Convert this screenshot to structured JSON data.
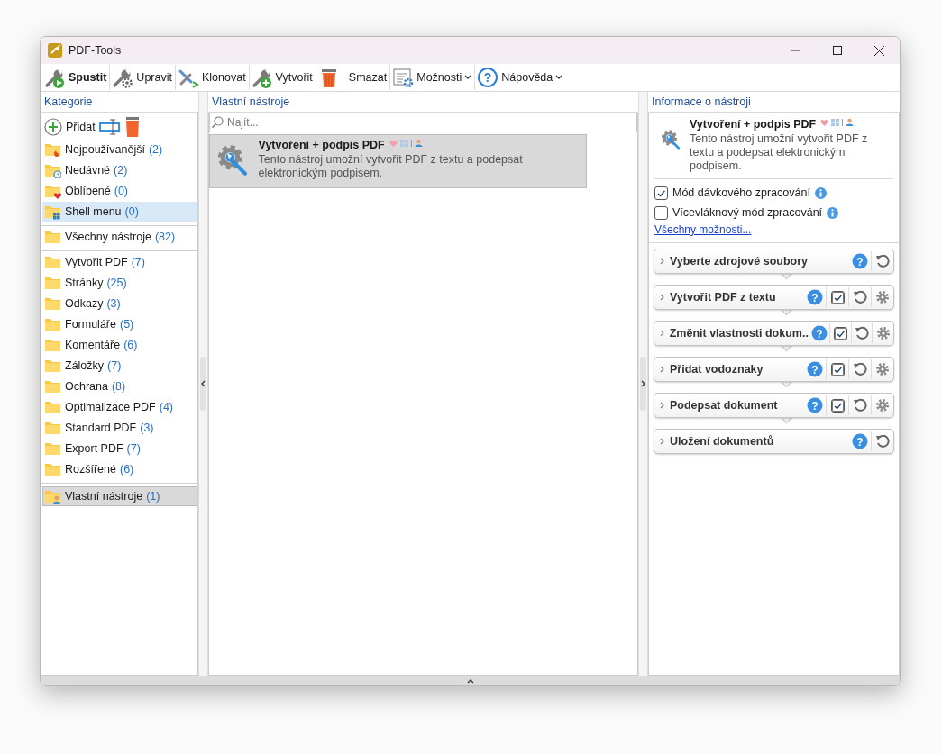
{
  "window": {
    "title": "PDF-Tools"
  },
  "toolbar": [
    {
      "label": "Spustit",
      "kind": "run",
      "default": true,
      "dropdown": false
    },
    {
      "label": "Upravit",
      "kind": "edit",
      "default": false,
      "dropdown": false
    },
    {
      "label": "Klonovat",
      "kind": "clone",
      "default": false,
      "dropdown": false
    },
    {
      "label": "Vytvořit",
      "kind": "create",
      "default": false,
      "dropdown": false
    },
    {
      "label": "Smazat",
      "kind": "delete",
      "default": false,
      "dropdown": false
    },
    {
      "label": "Možnosti",
      "kind": "options",
      "default": false,
      "dropdown": true
    },
    {
      "label": "Nápověda",
      "kind": "help",
      "default": false,
      "dropdown": true,
      "glyph": "?"
    }
  ],
  "categories": {
    "header": "Kategorie",
    "add_label": "Přidat",
    "groups": [
      [
        {
          "name": "Nejpoužívanější",
          "count": "(2)",
          "kind": "fire",
          "hovered": false,
          "selected": false
        },
        {
          "name": "Nedávné",
          "count": "(2)",
          "kind": "clock",
          "hovered": false,
          "selected": false
        },
        {
          "name": "Oblíbené",
          "count": "(0)",
          "kind": "heart",
          "hovered": false,
          "selected": false
        },
        {
          "name": "Shell menu",
          "count": "(0)",
          "kind": "windows",
          "hovered": true,
          "selected": false
        }
      ],
      [
        {
          "name": "Všechny nástroje",
          "count": "(82)",
          "kind": "plain",
          "hovered": false,
          "selected": false
        }
      ],
      [
        {
          "name": "Vytvořit PDF",
          "count": "(7)",
          "kind": "plain",
          "hovered": false,
          "selected": false
        },
        {
          "name": "Stránky",
          "count": "(25)",
          "kind": "plain",
          "hovered": false,
          "selected": false
        },
        {
          "name": "Odkazy",
          "count": "(3)",
          "kind": "plain",
          "hovered": false,
          "selected": false
        },
        {
          "name": "Formuláře",
          "count": "(5)",
          "kind": "plain",
          "hovered": false,
          "selected": false
        },
        {
          "name": "Komentáře",
          "count": "(6)",
          "kind": "plain",
          "hovered": false,
          "selected": false
        },
        {
          "name": "Záložky",
          "count": "(7)",
          "kind": "plain",
          "hovered": false,
          "selected": false
        },
        {
          "name": "Ochrana",
          "count": "(8)",
          "kind": "plain",
          "hovered": false,
          "selected": false
        },
        {
          "name": "Optimalizace PDF",
          "count": "(4)",
          "kind": "plain",
          "hovered": false,
          "selected": false
        },
        {
          "name": "Standard PDF",
          "count": "(3)",
          "kind": "plain",
          "hovered": false,
          "selected": false
        },
        {
          "name": "Export PDF",
          "count": "(7)",
          "kind": "plain",
          "hovered": false,
          "selected": false
        },
        {
          "name": "Rozšířené",
          "count": "(6)",
          "kind": "plain",
          "hovered": false,
          "selected": false
        }
      ],
      [
        {
          "name": "Vlastní nástroje",
          "count": "(1)",
          "kind": "user",
          "hovered": false,
          "selected": true
        }
      ]
    ]
  },
  "tools": {
    "header": "Vlastní nástroje",
    "search": {
      "placeholder": "Najít..."
    },
    "items": [
      {
        "title": "Vytvoření + podpis PDF",
        "description": "Tento nástroj umožní vytvořit PDF z textu a podepsat elektronickým podpisem.",
        "selected": true
      }
    ]
  },
  "info": {
    "header": "Informace o nástroji",
    "title": "Vytvoření + podpis PDF",
    "description": "Tento nástroj umožní vytvořit PDF z textu a podepsat elektronickým podpisem.",
    "options": [
      {
        "label": "Mód dávkového zpracování",
        "checked": true
      },
      {
        "label": "Vícevláknový mód zpracování",
        "checked": false
      }
    ],
    "link": "Všechny možnosti...",
    "steps": [
      {
        "title": "Vyberte zdrojové soubory",
        "help": "?",
        "checkable": false,
        "configurable": false
      },
      {
        "title": "Vytvořit PDF z textu",
        "help": "?",
        "checkable": true,
        "checked": true,
        "configurable": true
      },
      {
        "title": "Změnit vlastnosti dokum..",
        "help": "?",
        "checkable": true,
        "checked": true,
        "configurable": true
      },
      {
        "title": "Přidat vodoznaky",
        "help": "?",
        "checkable": true,
        "checked": true,
        "configurable": true
      },
      {
        "title": "Podepsat dokument",
        "help": "?",
        "checkable": true,
        "checked": true,
        "configurable": true
      },
      {
        "title": "Uložení dokumentů",
        "help": "?",
        "checkable": false,
        "configurable": false
      }
    ]
  }
}
